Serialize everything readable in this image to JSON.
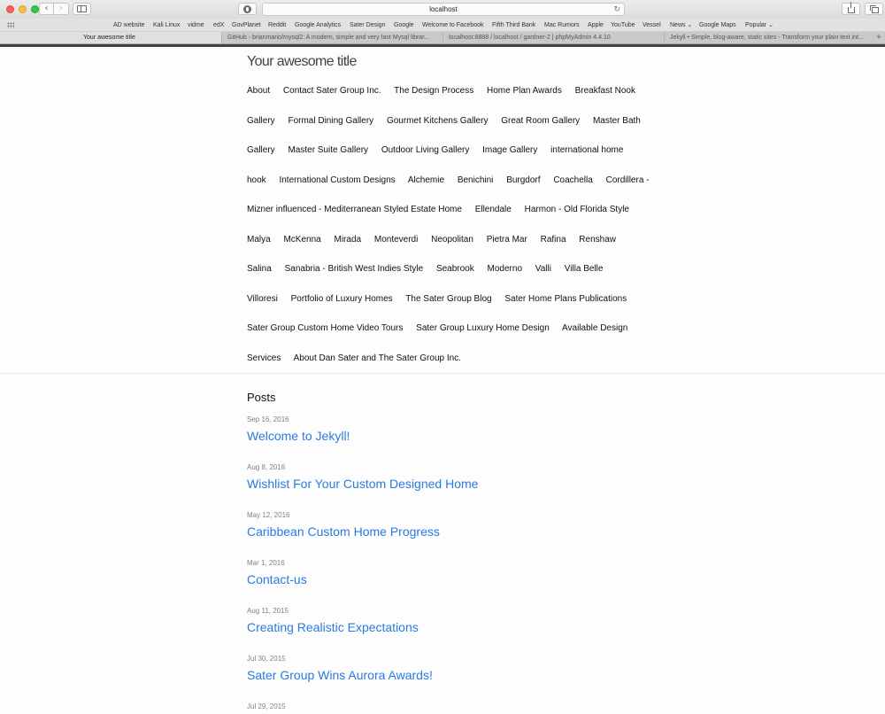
{
  "browser": {
    "url": "localhost",
    "nav_back": "‹",
    "nav_forward": "›",
    "reload_icon": "↻",
    "new_tab": "+",
    "bookmarks": [
      "AD website",
      "Kali Linux",
      "vidme",
      "edX",
      "GovPlanet",
      "Reddit",
      "Google Analytics",
      "Sater Design",
      "Google",
      "Welcome to Facebook",
      "Fifth Third Bank",
      "Mac Rumors",
      "Apple",
      "YouTube",
      "Vessel",
      "News ⌄",
      "Google Maps",
      "Popular ⌄"
    ],
    "tabs": [
      "Your awesome title",
      "GitHub - brianmario/mysql2: A modern, simple and very fast Mysql librar...",
      "localhost:8888 / localhost / gardner-2 | phpMyAdmin 4.4.10",
      "Jekyll • Simple, blog-aware, static sites - Transform your plain text int..."
    ]
  },
  "site": {
    "title": "Your awesome title",
    "nav": [
      "About",
      "Contact Sater Group Inc.",
      "The Design Process",
      "Home Plan Awards",
      "Breakfast Nook Gallery",
      "Formal Dining Gallery",
      "Gourmet Kitchens Gallery",
      "Great Room Gallery",
      "Master Bath Gallery",
      "Master Suite Gallery",
      "Outdoor Living Gallery",
      "Image Gallery",
      "international home hook",
      "International Custom Designs",
      "Alchemie",
      "Benichini",
      "Burgdorf",
      "Coachella",
      "Cordillera - Mizner influenced - Mediterranean Styled Estate Home",
      "Ellendale",
      "Harmon - Old Florida Style",
      "Malya",
      "McKenna",
      "Mirada",
      "Monteverdi",
      "Neopolitan",
      "Pietra Mar",
      "Rafina",
      "Renshaw",
      "Salina",
      "Sanabria - British West Indies Style",
      "Seabrook",
      "Moderno",
      "Valli",
      "Villa Belle",
      "Villoresi",
      "Portfolio of Luxury Homes",
      "The Sater Group Blog",
      "Sater Home Plans Publications",
      "Sater Group Custom Home Video Tours",
      "Sater Group Luxury Home Design",
      "Available Design Services",
      "About Dan Sater and The Sater Group Inc."
    ]
  },
  "posts": {
    "heading": "Posts",
    "items": [
      {
        "date": "Sep 16, 2016",
        "title": "Welcome to Jekyll!"
      },
      {
        "date": "Aug 8, 2016",
        "title": "Wishlist For Your Custom Designed Home"
      },
      {
        "date": "May 12, 2016",
        "title": "Caribbean Custom Home Progress"
      },
      {
        "date": "Mar 1, 2016",
        "title": "Contact-us"
      },
      {
        "date": "Aug 11, 2015",
        "title": "Creating Realistic Expectations"
      },
      {
        "date": "Jul 30, 2015",
        "title": "Sater Group Wins Aurora Awards!"
      },
      {
        "date": "Jul 29, 2015",
        "title": ""
      }
    ]
  },
  "colors": {
    "link": "#2a7ae2",
    "meta": "#828282",
    "title": "#424242"
  }
}
